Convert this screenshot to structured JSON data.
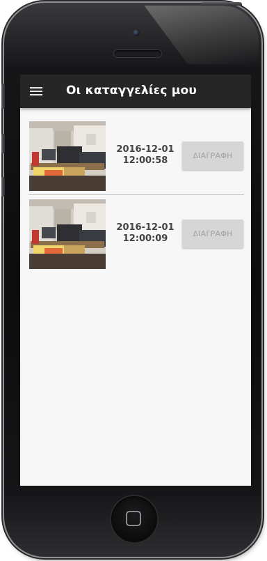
{
  "app_bar": {
    "title": "Οι καταγγελίες μου",
    "menu_icon": "hamburger-menu-icon"
  },
  "reports": [
    {
      "date": "2016-12-01",
      "time": "12:00:58",
      "delete_label": "ΔΙΑΓΡΑΦΗ",
      "thumbnail": "office-room-photo"
    },
    {
      "date": "2016-12-01",
      "time": "12:00:09",
      "delete_label": "ΔΙΑΓΡΑΦΗ",
      "thumbnail": "office-room-photo"
    }
  ],
  "colors": {
    "app_bar": "#262626",
    "screen_background": "#f7f7f7",
    "button_disabled": "#d6d6d6",
    "button_text_disabled": "#a2a2a2",
    "timestamp_text": "#424242"
  }
}
